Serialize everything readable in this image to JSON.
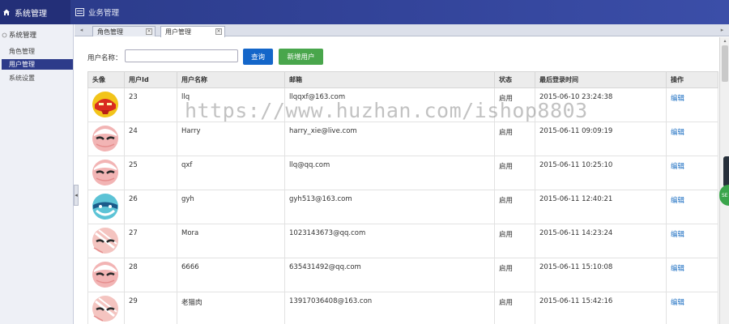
{
  "header": {
    "app_title": "系统管理",
    "module_tab": "业务管理"
  },
  "sidebar": {
    "group_label": "系统管理",
    "items": [
      {
        "label": "角色管理",
        "active": false
      },
      {
        "label": "用户管理",
        "active": true
      },
      {
        "label": "系统设置",
        "active": false
      }
    ]
  },
  "tabs": [
    {
      "label": "角色管理",
      "active": false
    },
    {
      "label": "用户管理",
      "active": true
    }
  ],
  "search": {
    "label": "用户名称：",
    "value": "",
    "query_button": "查询",
    "add_button": "新增用户"
  },
  "table": {
    "columns": [
      "头像",
      "用户Id",
      "用户名称",
      "邮箱",
      "状态",
      "最后登录时间",
      "操作"
    ],
    "rows": [
      {
        "avatar": "ironman",
        "id": "23",
        "name": "llq",
        "email": "llqqxf@163.com",
        "status": "启用",
        "last_login": "2015-06-10 23:24:38",
        "action": "编辑"
      },
      {
        "avatar": "pink-dark",
        "id": "24",
        "name": "Harry",
        "email": "harry_xie@live.com",
        "status": "启用",
        "last_login": "2015-06-11 09:09:19",
        "action": "编辑"
      },
      {
        "avatar": "pink-dark",
        "id": "25",
        "name": "qxf",
        "email": "llq@qq.com",
        "status": "启用",
        "last_login": "2015-06-11 10:25:10",
        "action": "编辑"
      },
      {
        "avatar": "blue",
        "id": "26",
        "name": "gyh",
        "email": "gyh513@163.com",
        "status": "启用",
        "last_login": "2015-06-11 12:40:21",
        "action": "编辑"
      },
      {
        "avatar": "pink-stripe",
        "id": "27",
        "name": "Mora",
        "email": "1023143673@qq.com",
        "status": "启用",
        "last_login": "2015-06-11 14:23:24",
        "action": "编辑"
      },
      {
        "avatar": "pink-dark",
        "id": "28",
        "name": "6666",
        "email": "635431492@qq.com",
        "status": "启用",
        "last_login": "2015-06-11 15:10:08",
        "action": "编辑"
      },
      {
        "avatar": "pink-stripe",
        "id": "29",
        "name": "老猫肉",
        "email": "13917036408@163.con",
        "status": "启用",
        "last_login": "2015-06-11 15:42:16",
        "action": "编辑"
      }
    ]
  },
  "colors": {
    "topbar": "#2a3a88",
    "sidebar_active": "#2d3b8a",
    "query_button": "#1466c9",
    "add_button": "#49a64c",
    "link": "#1b6ec2"
  },
  "watermark": "https://www.huzhan.com/ishop8803",
  "edge_widget_text": "SE"
}
